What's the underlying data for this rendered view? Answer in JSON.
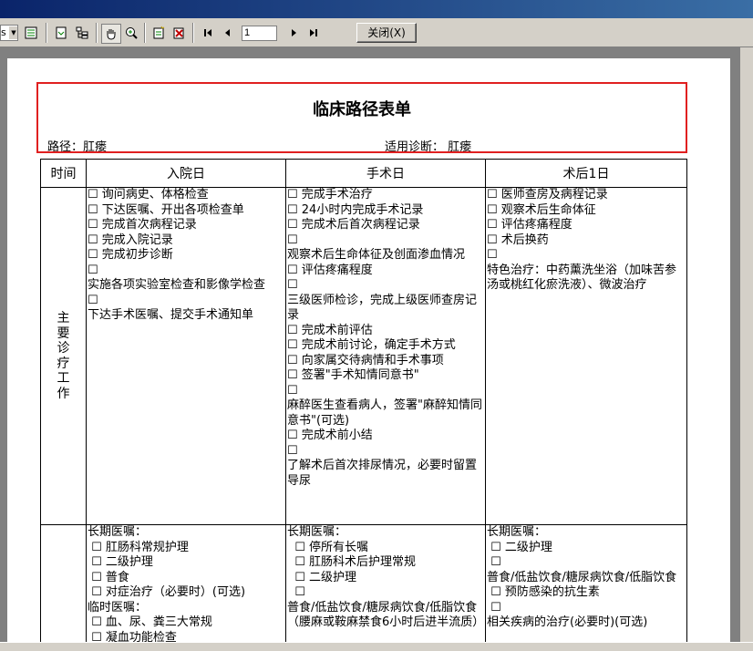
{
  "toolbar": {
    "zoom_fragment": "s",
    "page_input": "1",
    "close_label": "关闭(X)"
  },
  "document": {
    "title": "临床路径表单",
    "path_label": "路径：肛瘘",
    "diagnosis_label": "适用诊断：  肛瘘"
  },
  "table": {
    "headers": [
      "时间",
      "入院日",
      "手术日",
      "术后1日"
    ],
    "row1_label": "主要诊疗工作",
    "row1": {
      "admission": [
        "☐ 询问病史、体格检查",
        "☐ 下达医嘱、开出各项检查单",
        "☐ 完成首次病程记录",
        "☐ 完成入院记录",
        "☐ 完成初步诊断",
        "☐",
        "实施各项实验室检查和影像学检查",
        "☐",
        "下达手术医嘱、提交手术通知单"
      ],
      "surgery": [
        "☐ 完成手术治疗",
        "☐ 24小时内完成手术记录",
        "☐ 完成术后首次病程记录",
        "☐",
        "观察术后生命体征及创面渗血情况",
        "☐ 评估疼痛程度",
        "☐",
        "三级医师检诊，完成上级医师查房记录",
        "☐ 完成术前评估",
        "☐ 完成术前讨论，确定手术方式",
        "☐ 向家属交待病情和手术事项",
        "☐ 签署\"手术知情同意书\"",
        "☐",
        "麻醉医生查看病人，签署\"麻醉知情同意书\"(可选)",
        "☐ 完成术前小结",
        "☐",
        "了解术后首次排尿情况，必要时留置导尿"
      ],
      "postop": [
        "☐ 医师查房及病程记录",
        "☐ 观察术后生命体征",
        "☐ 评估疼痛程度",
        "☐ 术后换药",
        "☐",
        "特色治疗：中药薰洗坐浴（加味苦参汤或桃红化瘀洗液）、微波治疗"
      ]
    },
    "row2": {
      "admission": [
        "长期医嘱：",
        " ☐ 肛肠科常规护理",
        " ☐ 二级护理",
        " ☐ 普食",
        " ☐ 对症治疗（必要时）(可选)",
        "临时医嘱：",
        " ☐ 血、尿、粪三大常规",
        " ☐ 凝血功能检查"
      ],
      "surgery": [
        "长期医嘱：",
        "  ☐ 停所有长嘱",
        "  ☐ 肛肠科术后护理常规",
        "  ☐ 二级护理",
        "  ☐",
        "普食/低盐饮食/糖尿病饮食/低脂饮食（腰麻或鞍麻禁食6小时后进半流质）"
      ],
      "postop": [
        "长期医嘱：",
        " ☐ 二级护理",
        " ☐",
        "普食/低盐饮食/糖尿病饮食/低脂饮食",
        " ☐ 预防感染的抗生素",
        " ☐",
        "相关疾病的治疗(必要时)(可选)"
      ]
    }
  }
}
